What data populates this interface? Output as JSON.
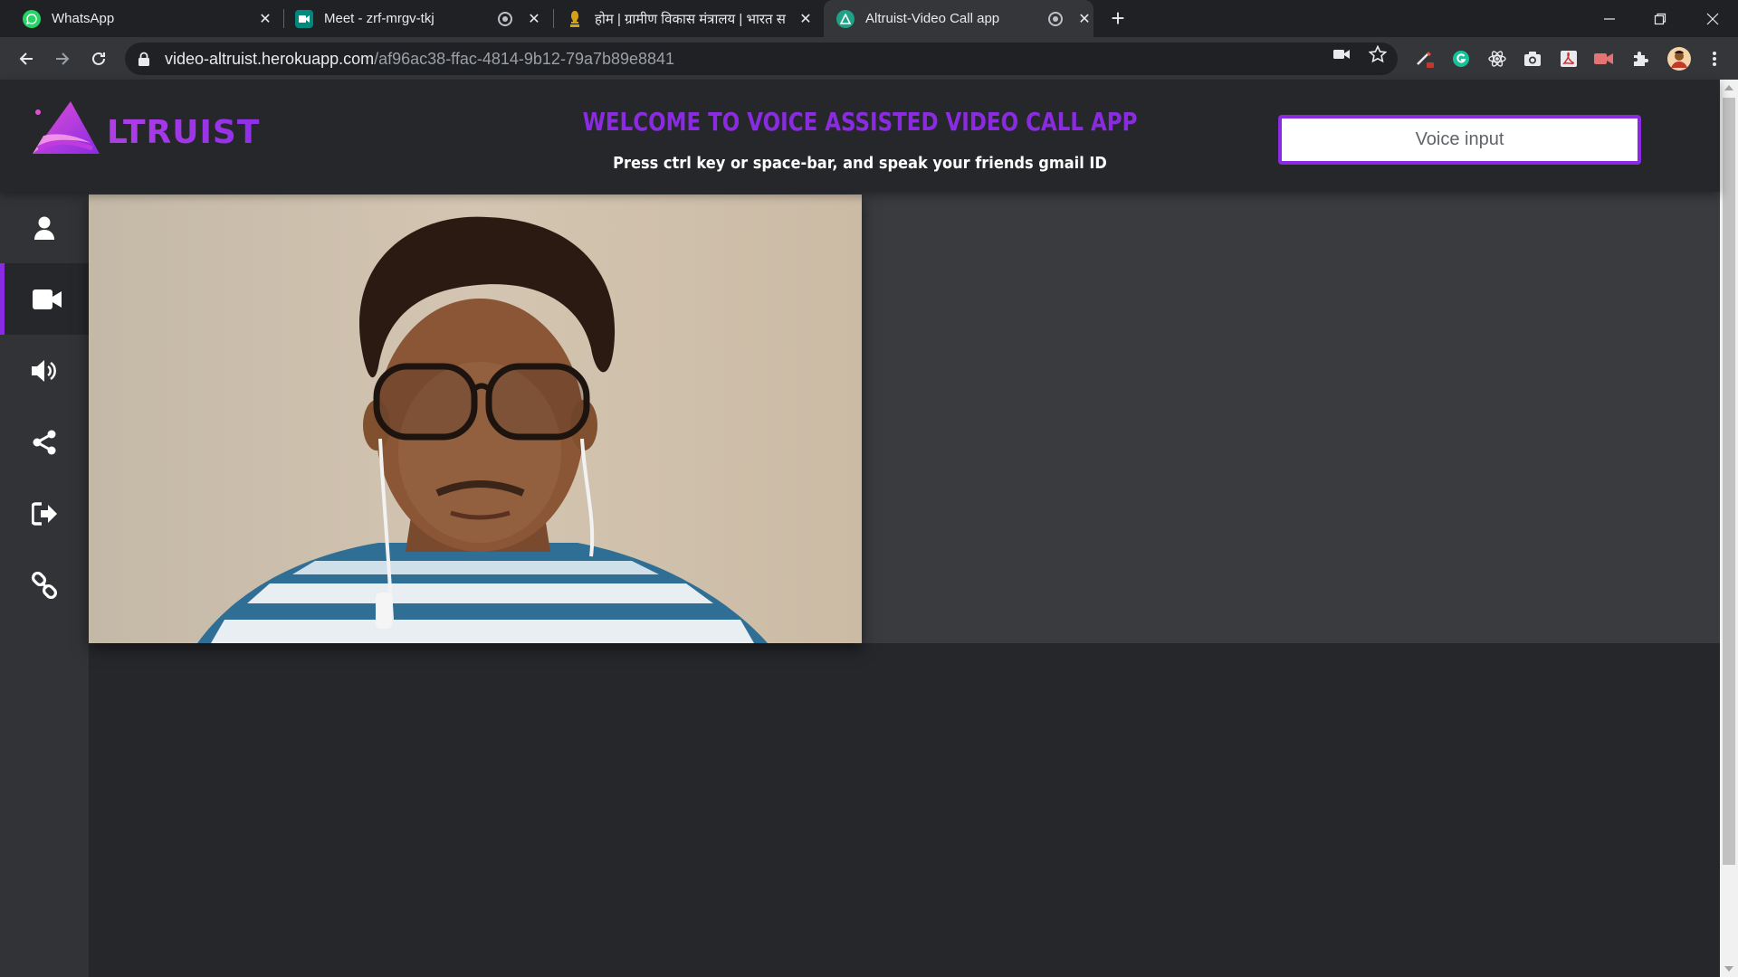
{
  "browser": {
    "tabs": [
      {
        "title": "WhatsApp",
        "icon": "whatsapp-icon"
      },
      {
        "title": "Meet - zrf-mrgv-tkj",
        "icon": "google-meet-icon"
      },
      {
        "title": "होम | ग्रामीण विकास मंत्रालय | भारत स",
        "icon": "emblem-icon"
      },
      {
        "title": "Altruist-Video Call app",
        "icon": "altruist-icon"
      }
    ],
    "new_tab": "+",
    "url_host": "video-altruist.herokuapp.com",
    "url_path": "/af96ac38-ffac-4814-9b12-79a7b89e8841"
  },
  "header": {
    "logo_text": "LTRUIST",
    "welcome": "WELCOME TO VOICE ASSISTED VIDEO CALL APP",
    "subtitle": "Press ctrl key or space-bar, and speak your friends gmail ID",
    "voice_button": "Voice input"
  },
  "sidebar": {
    "items": [
      {
        "icon": "user-icon",
        "active": false
      },
      {
        "icon": "video-camera-icon",
        "active": true
      },
      {
        "icon": "volume-icon",
        "active": false
      },
      {
        "icon": "share-icon",
        "active": false
      },
      {
        "icon": "sign-out-icon",
        "active": false
      },
      {
        "icon": "link-icon",
        "active": false
      }
    ]
  },
  "colors": {
    "accent": "#8a2be2",
    "header_bg": "#26272b",
    "sidebar_bg": "#323337",
    "stage_bg": "#3a3b3f"
  }
}
